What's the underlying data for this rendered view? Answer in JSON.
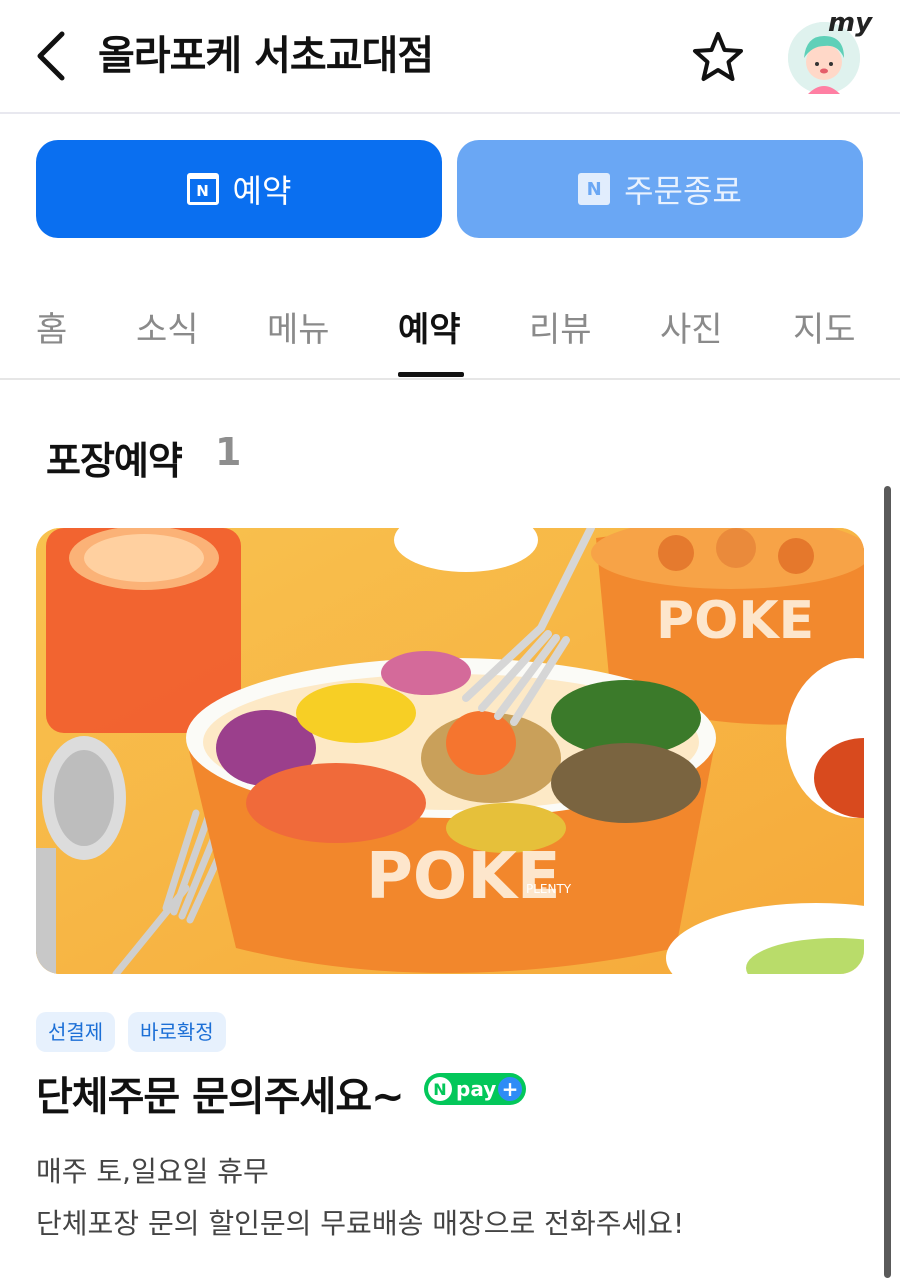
{
  "header": {
    "title": "올라포케 서초교대점",
    "avatar_label": "my",
    "back_icon": "back-arrow-icon",
    "favorite_icon": "star-outline-icon"
  },
  "actions": {
    "reserve": {
      "label": "예약",
      "icon": "naver-calendar-icon",
      "color": "#0a6ff0"
    },
    "order": {
      "label": "주문종료",
      "icon": "naver-n-icon",
      "color": "#6aa7f4"
    }
  },
  "tabs": [
    {
      "label": "홈"
    },
    {
      "label": "소식"
    },
    {
      "label": "메뉴"
    },
    {
      "label": "예약",
      "active": true
    },
    {
      "label": "리뷰"
    },
    {
      "label": "사진"
    },
    {
      "label": "지도"
    }
  ],
  "section": {
    "title": "포장예약",
    "count": "1"
  },
  "item": {
    "badges": [
      "선결제",
      "바로확정"
    ],
    "title": "단체주문 문의주세요~",
    "npay": {
      "n": "N",
      "text": "pay",
      "plus": "+"
    },
    "description": [
      "매주 토,일요일 휴무",
      "단체포장 문의 할인문의 무료배송 매장으로 전화주세요!"
    ],
    "bowl_print": "PLENTY"
  }
}
